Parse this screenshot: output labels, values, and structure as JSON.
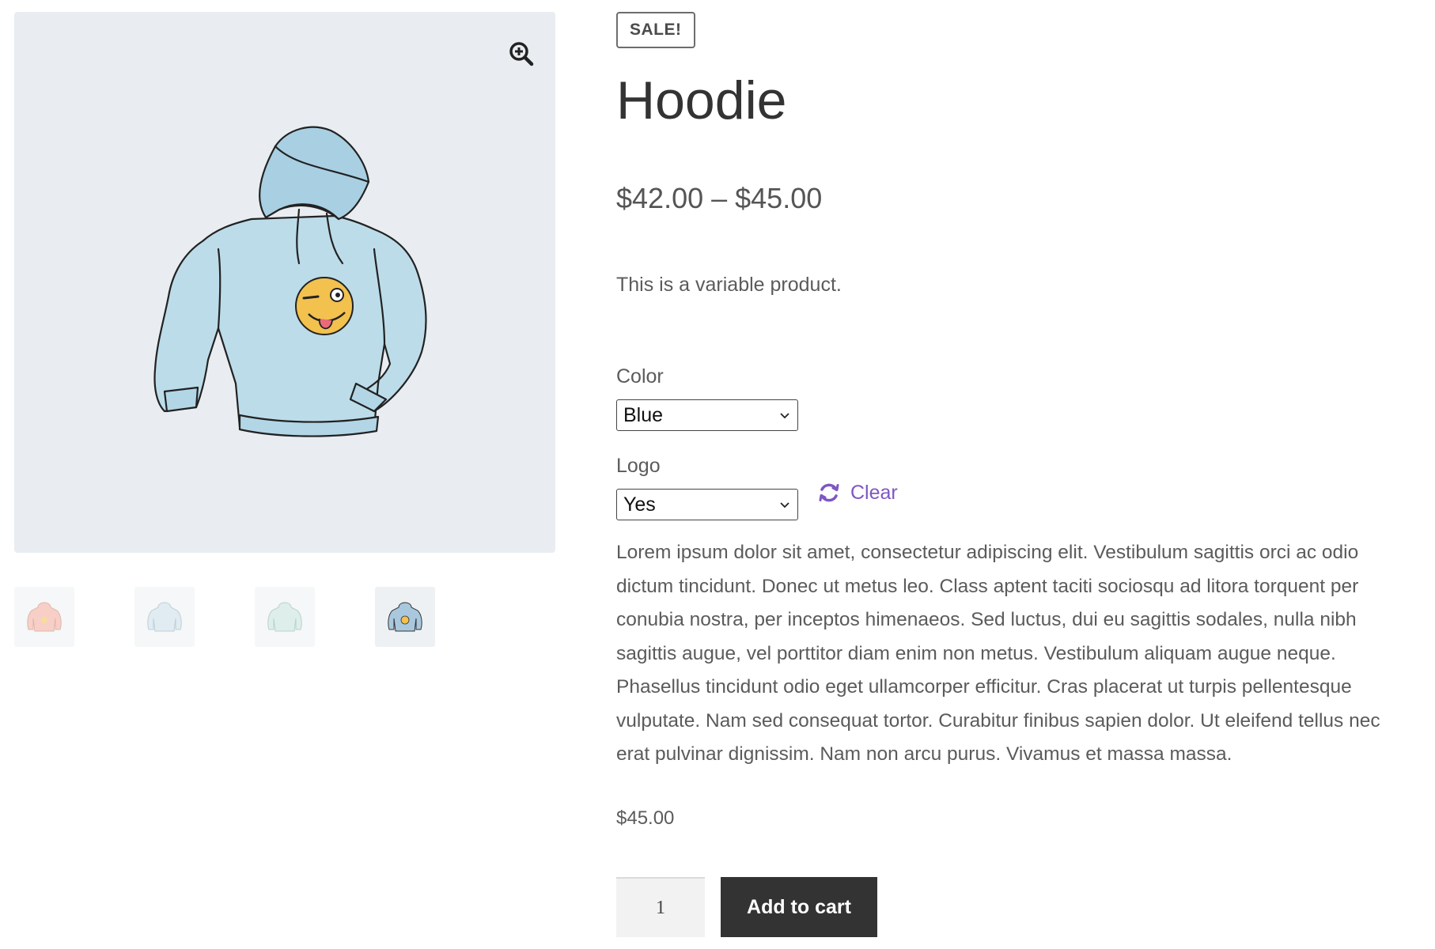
{
  "gallery": {
    "main_image_icon": "hoodie-blue-with-logo",
    "zoom_icon": "zoom-in-icon",
    "thumbnails": [
      {
        "icon": "hoodie-pink",
        "color": "#f2a99a"
      },
      {
        "icon": "hoodie-blue-faded",
        "color": "#c9dde8"
      },
      {
        "icon": "hoodie-green-faded",
        "color": "#c3e1db"
      },
      {
        "icon": "hoodie-blue-with-logo",
        "color": "#a9c8de"
      }
    ]
  },
  "product": {
    "badge": "SALE!",
    "title": "Hoodie",
    "price_range": "$42.00 – $45.00",
    "short_description": "This is a variable product.",
    "attributes": {
      "color": {
        "label": "Color",
        "selected": "Blue"
      },
      "logo": {
        "label": "Logo",
        "selected": "Yes"
      }
    },
    "clear_label": "Clear",
    "description": "Lorem ipsum dolor sit amet, consectetur adipiscing elit. Vestibulum sagittis orci ac odio dictum tincidunt. Donec ut metus leo. Class aptent taciti sociosqu ad litora torquent per conubia nostra, per inceptos himenaeos. Sed luctus, dui eu sagittis sodales, nulla nibh sagittis augue, vel porttitor diam enim non metus. Vestibulum aliquam augue neque. Phasellus tincidunt odio eget ullamcorper efficitur. Cras placerat ut turpis pellentesque vulputate. Nam sed consequat tortor. Curabitur finibus sapien dolor. Ut eleifend tellus nec erat pulvinar dignissim. Nam non arcu purus. Vivamus et massa massa.",
    "variation_price": "$45.00",
    "quantity": "1",
    "add_to_cart_label": "Add to cart"
  },
  "colors": {
    "accent": "#7e57c2",
    "button_bg": "#333333",
    "image_bg": "#e9edf1"
  }
}
